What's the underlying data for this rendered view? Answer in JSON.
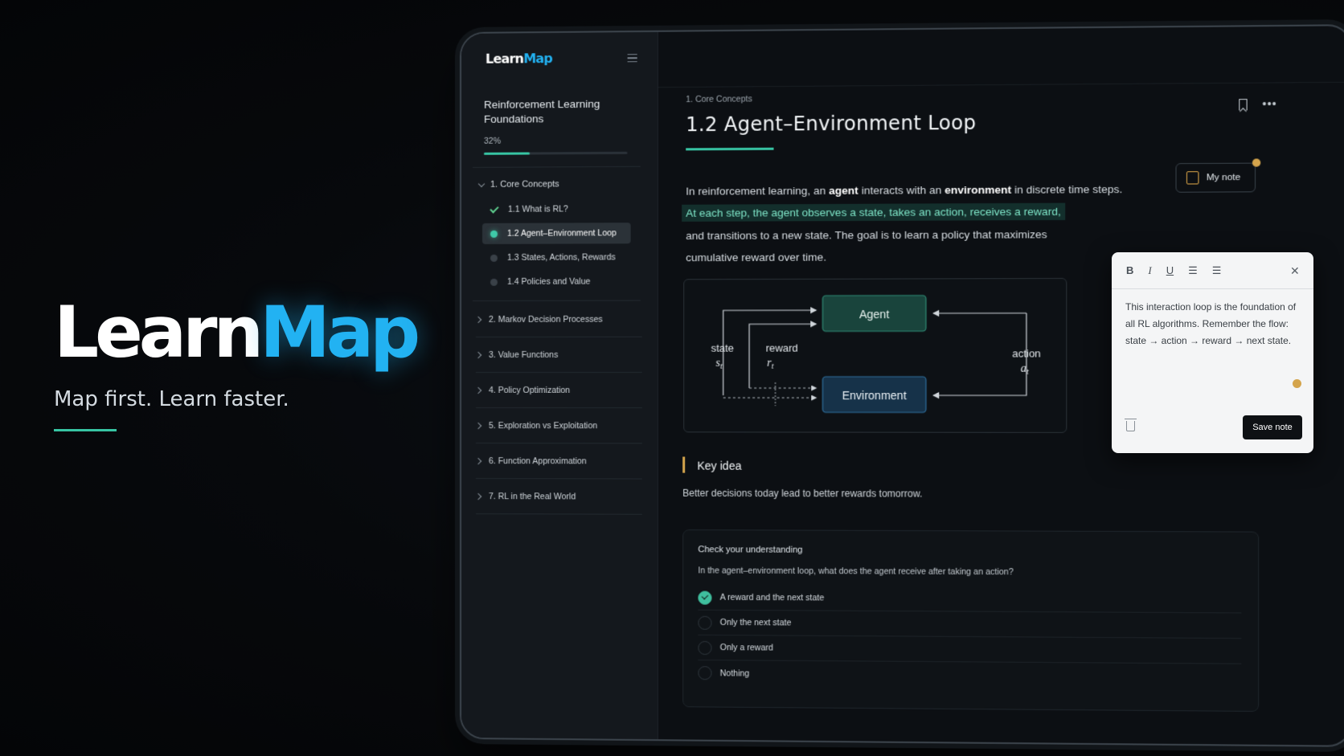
{
  "hero": {
    "logo_a": "Learn",
    "logo_b": "Map",
    "tagline": "Map first. Learn faster."
  },
  "sidebar": {
    "brand_a": "Learn",
    "brand_b": "Map",
    "course_title": "Reinforcement Learning Foundations",
    "progress_label": "32%",
    "progress": 0.32,
    "current_module": "1. Core Concepts",
    "lessons": [
      {
        "label": "1.1  What is RL?",
        "state": "done"
      },
      {
        "label": "1.2  Agent–Environment Loop",
        "state": "active"
      },
      {
        "label": "1.3  States, Actions, Rewards",
        "state": "todo"
      },
      {
        "label": "1.4  Policies and Value",
        "state": "todo"
      }
    ],
    "modules": [
      "2. Markov Decision Processes",
      "3. Value Functions",
      "4. Policy Optimization",
      "5. Exploration vs Exploitation",
      "6. Function Approximation",
      "7. RL in the Real World"
    ]
  },
  "main": {
    "breadcrumb": "1.  Core Concepts",
    "title": "1.2  Agent–Environment Loop",
    "my_note": "My note",
    "para1_a": "In reinforcement learning, an ",
    "para1_b": "agent",
    "para1_c": " interacts with an ",
    "para1_d": "environment",
    "para1_e": " in discrete time steps.",
    "para2": "At each step, the agent observes a state, takes an action, receives a reward,",
    "para3": "and transitions to a new state. The goal is to learn a policy that maximizes",
    "para4": "cumulative reward over time.",
    "diagram": {
      "agent": "Agent",
      "environment": "Environment",
      "state": "state",
      "state_sym": "s",
      "state_sub": "t",
      "reward": "reward",
      "reward_sym": "r",
      "reward_sub": "t",
      "action": "action",
      "action_sym": "a",
      "action_sub": "t"
    },
    "key_idea_title": "Key idea",
    "key_idea_text": "Better decisions today lead to better rewards tomorrow.",
    "quiz": {
      "title": "Check your understanding",
      "question": "In the agent–environment loop, what does the agent receive after taking an action?",
      "options": [
        {
          "label": "A reward and the next state",
          "selected": true
        },
        {
          "label": "Only the next state",
          "selected": false
        },
        {
          "label": "Only a reward",
          "selected": false
        },
        {
          "label": "Nothing",
          "selected": false
        }
      ]
    }
  },
  "note_popup": {
    "tools": {
      "bold": "B",
      "italic": "I",
      "underline": "U"
    },
    "text": "This interaction loop is the foundation of all RL algorithms. Remember the flow: state → action → reward → next state.",
    "save": "Save note"
  },
  "colors": {
    "accent": "#37c4a3",
    "brand_blue": "#22b2f2",
    "note_orange": "#d4a44c"
  }
}
